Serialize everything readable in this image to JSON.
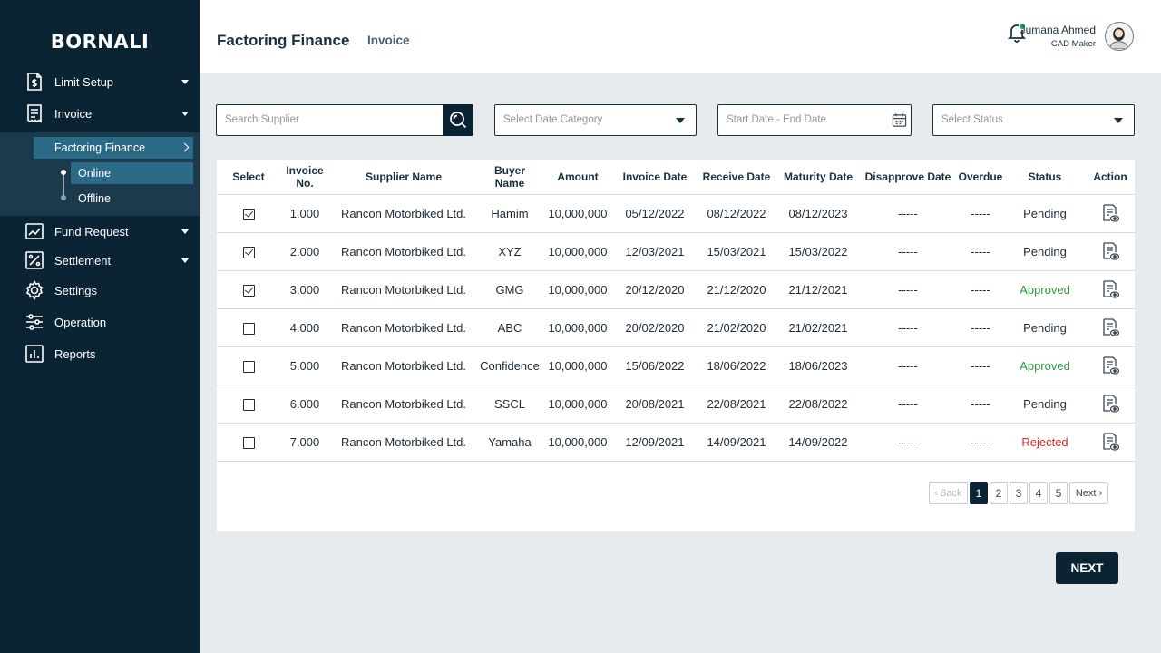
{
  "sidebar": {
    "brand": "BORNALI",
    "items": [
      {
        "label": "Limit Setup",
        "icon": "document-money-icon"
      },
      {
        "label": "Invoice",
        "icon": "invoice-icon"
      },
      {
        "label": "Fund Request",
        "icon": "chart-up-icon"
      },
      {
        "label": "Settlement",
        "icon": "percent-icon"
      },
      {
        "label": "Settings",
        "icon": "gear-icon"
      },
      {
        "label": "Operation",
        "icon": "sliders-icon"
      },
      {
        "label": "Reports",
        "icon": "bar-chart-icon"
      }
    ],
    "sub_item": "Factoring Finance",
    "sub_sub_items": [
      "Online",
      "Offline"
    ]
  },
  "header": {
    "title": "Factoring Finance",
    "subtitle": "Invoice",
    "user_name": "Jumana Ahmed",
    "user_role": "CAD Maker"
  },
  "filters": {
    "search_placeholder": "Search Supplier",
    "date_category_placeholder": "Select Date Category",
    "date_range_placeholder": "Start Date - End Date",
    "status_placeholder": "Select Status"
  },
  "table": {
    "columns": [
      "Select",
      "Invoice No.",
      "Supplier Name",
      "Buyer Name",
      "Amount",
      "Invoice Date",
      "Receive Date",
      "Maturity Date",
      "Disapprove Date",
      "Overdue",
      "Status",
      "Action"
    ],
    "rows": [
      {
        "checked": true,
        "invoice_no": "1.000",
        "supplier": "Rancon Motorbiked Ltd.",
        "buyer": "Hamim",
        "amount": "10,000,000",
        "invoice_date": "05/12/2022",
        "receive_date": "08/12/2022",
        "maturity_date": "08/12/2023",
        "disapprove_date": "-----",
        "overdue": "-----",
        "status": "Pending"
      },
      {
        "checked": true,
        "invoice_no": "2.000",
        "supplier": "Rancon Motorbiked Ltd.",
        "buyer": "XYZ",
        "amount": "10,000,000",
        "invoice_date": "12/03/2021",
        "receive_date": "15/03/2021",
        "maturity_date": "15/03/2022",
        "disapprove_date": "-----",
        "overdue": "-----",
        "status": "Pending"
      },
      {
        "checked": true,
        "invoice_no": "3.000",
        "supplier": "Rancon Motorbiked Ltd.",
        "buyer": "GMG",
        "amount": "10,000,000",
        "invoice_date": "20/12/2020",
        "receive_date": "21/12/2020",
        "maturity_date": "21/12/2021",
        "disapprove_date": "-----",
        "overdue": "-----",
        "status": "Approved"
      },
      {
        "checked": false,
        "invoice_no": "4.000",
        "supplier": "Rancon Motorbiked Ltd.",
        "buyer": "ABC",
        "amount": "10,000,000",
        "invoice_date": "20/02/2020",
        "receive_date": "21/02/2020",
        "maturity_date": "21/02/2021",
        "disapprove_date": "-----",
        "overdue": "-----",
        "status": "Pending"
      },
      {
        "checked": false,
        "invoice_no": "5.000",
        "supplier": "Rancon Motorbiked Ltd.",
        "buyer": "Confidence",
        "amount": "10,000,000",
        "invoice_date": "15/06/2022",
        "receive_date": "18/06/2022",
        "maturity_date": "18/06/2023",
        "disapprove_date": "-----",
        "overdue": "-----",
        "status": "Approved"
      },
      {
        "checked": false,
        "invoice_no": "6.000",
        "supplier": "Rancon Motorbiked Ltd.",
        "buyer": "SSCL",
        "amount": "10,000,000",
        "invoice_date": "20/08/2021",
        "receive_date": "22/08/2021",
        "maturity_date": "22/08/2022",
        "disapprove_date": "-----",
        "overdue": "-----",
        "status": "Pending"
      },
      {
        "checked": false,
        "invoice_no": "7.000",
        "supplier": "Rancon Motorbiked Ltd.",
        "buyer": "Yamaha",
        "amount": "10,000,000",
        "invoice_date": "12/09/2021",
        "receive_date": "14/09/2021",
        "maturity_date": "14/09/2022",
        "disapprove_date": "-----",
        "overdue": "-----",
        "status": "Rejected"
      }
    ]
  },
  "pagination": {
    "back_label": "Back",
    "next_label": "Next",
    "pages": [
      "1",
      "2",
      "3",
      "4",
      "5"
    ],
    "current_page": "1"
  },
  "footer": {
    "next_button": "NEXT"
  },
  "colors": {
    "sidebar_bg": "#0b2434",
    "accent": "#2a6a86",
    "approved": "#2e9a3d",
    "rejected": "#e02828",
    "notification_dot": "#22a95a"
  }
}
